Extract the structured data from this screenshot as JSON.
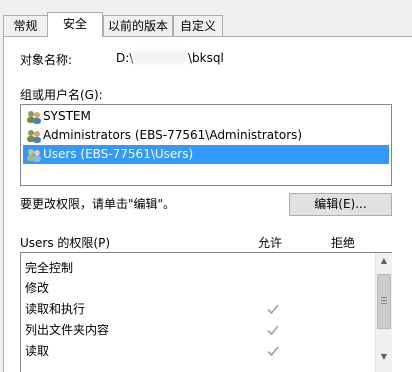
{
  "tabs": [
    {
      "label": "常规"
    },
    {
      "label": "安全"
    },
    {
      "label": "以前的版本"
    },
    {
      "label": "自定义"
    }
  ],
  "object": {
    "label": "对象名称:",
    "path_prefix": "D:\\",
    "path_suffix": "\\bksql"
  },
  "groups": {
    "label": "组或用户名(G):",
    "items": [
      {
        "name": "SYSTEM"
      },
      {
        "name": "Administrators (EBS-77561\\Administrators)"
      },
      {
        "name": "Users (EBS-77561\\Users)"
      }
    ]
  },
  "change_hint": "要更改权限，请单击\"编辑\"。",
  "edit_button": "编辑(E)...",
  "permissions": {
    "title": "Users 的权限(P)",
    "allow_header": "允许",
    "deny_header": "拒绝",
    "rows": [
      {
        "name": "完全控制",
        "allow": false,
        "deny": false
      },
      {
        "name": "修改",
        "allow": false,
        "deny": false
      },
      {
        "name": "读取和执行",
        "allow": true,
        "deny": false
      },
      {
        "name": "列出文件夹内容",
        "allow": true,
        "deny": false
      },
      {
        "name": "读取",
        "allow": true,
        "deny": false
      }
    ]
  },
  "colors": {
    "selection": "#3399ff",
    "check_gray": "#a0a0a0"
  }
}
